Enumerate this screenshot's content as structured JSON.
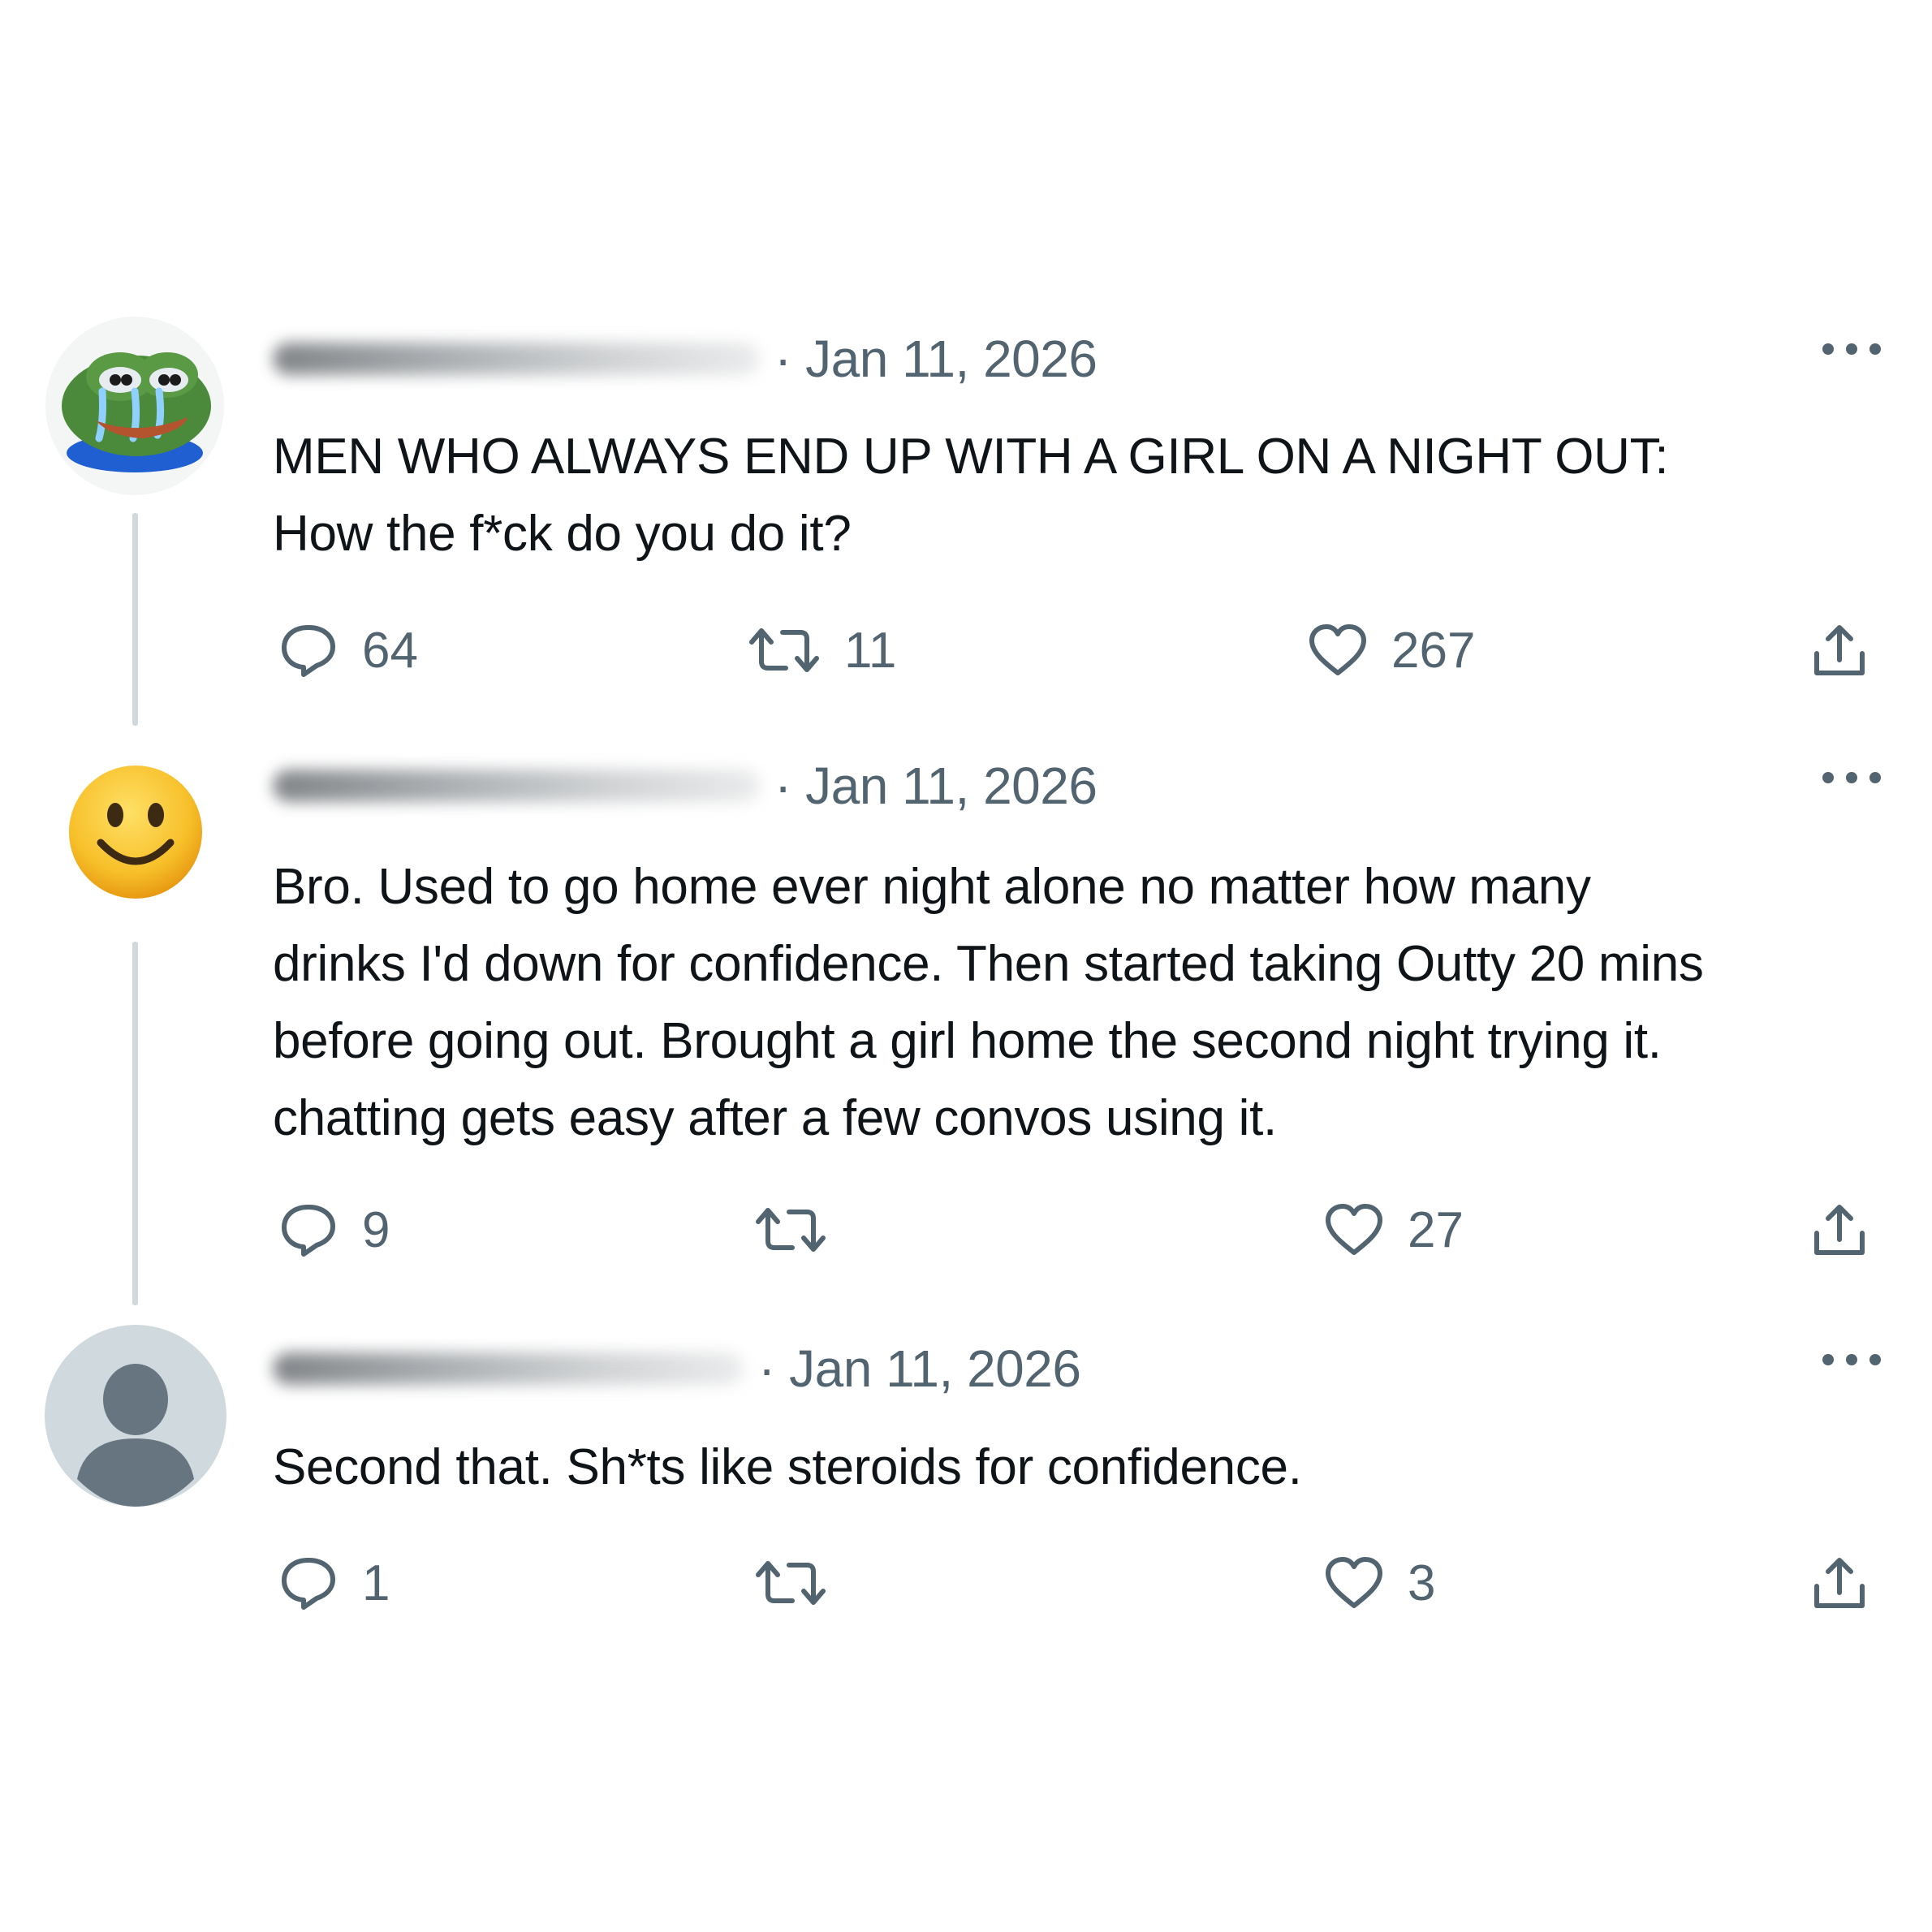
{
  "tweets": [
    {
      "name_redacted": "",
      "date": "· Jan 11, 2026",
      "text": "MEN WHO ALWAYS END UP WITH A GIRL ON A NIGHT OUT:\nHow the f*ck do you do it?",
      "replies": "64",
      "retweets": "11",
      "likes": "267",
      "avatar_icon": "pepe-crying-frog-avatar"
    },
    {
      "name_redacted": "",
      "date": "· Jan 11, 2026",
      "text": "Bro. Used to go home ever night alone no matter how many\ndrinks I'd down for confidence. Then started taking Outty 20 mins\nbefore going out. Brought a girl home the second night trying it.\nchatting gets easy after a few convos using it.",
      "replies": "9",
      "retweets": "",
      "likes": "27",
      "avatar_icon": "smiley-face-avatar"
    },
    {
      "name_redacted": "",
      "date": "· Jan 11, 2026",
      "text": "Second that. Sh*ts like steroids for confidence.",
      "replies": "1",
      "retweets": "",
      "likes": "3",
      "avatar_icon": "default-person-avatar"
    }
  ],
  "colors": {
    "text": "#0f1419",
    "secondary": "#536471",
    "thread_line": "#cfd9de",
    "background": "#ffffff"
  },
  "icons": [
    "reply-icon",
    "retweet-icon",
    "like-icon",
    "share-icon",
    "more-options-icon"
  ]
}
